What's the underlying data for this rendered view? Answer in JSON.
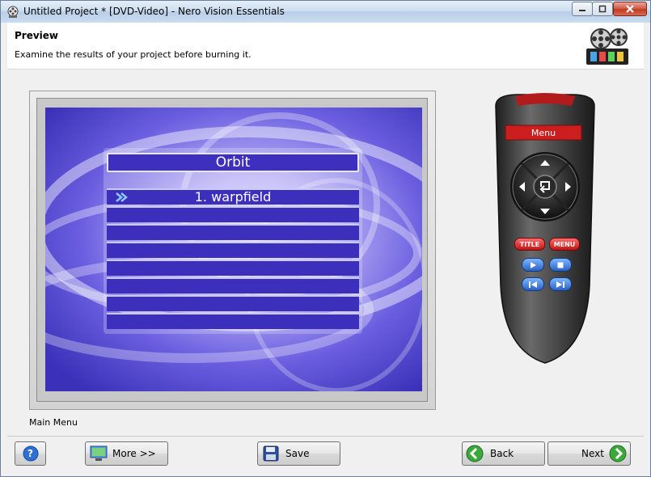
{
  "window": {
    "title": "Untitled Project * [DVD-Video] - Nero Vision Essentials",
    "controls": [
      "minimize",
      "maximize",
      "close"
    ]
  },
  "header": {
    "title": "Preview",
    "subtitle": "Examine the results of your project before burning it."
  },
  "preview": {
    "menu_title": "Orbit",
    "items": [
      "1. warpfield",
      "",
      "",
      "",
      "",
      "",
      "",
      ""
    ],
    "caption": "Main Menu"
  },
  "remote": {
    "display": "Menu",
    "title_button": "TITLE",
    "menu_button": "MENU",
    "colors": {
      "body": "#3a3a3a",
      "accent": "#cc1e1e",
      "blue": "#2f6fd0"
    }
  },
  "footer": {
    "help": "?",
    "more": "More >>",
    "save": "Save",
    "back": "Back",
    "next": "Next"
  }
}
